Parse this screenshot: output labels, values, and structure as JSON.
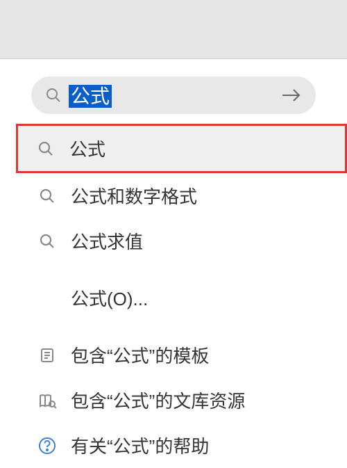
{
  "search": {
    "value": "公式"
  },
  "suggestions": [
    {
      "label": "公式",
      "icon": "search",
      "highlighted": true
    },
    {
      "label": "公式和数字格式",
      "icon": "search",
      "highlighted": false
    },
    {
      "label": "公式求值",
      "icon": "search",
      "highlighted": false
    }
  ],
  "commands": [
    {
      "label": "公式(O)...",
      "icon": "none"
    }
  ],
  "resources": [
    {
      "label": "包含“公式”的模板",
      "icon": "template"
    },
    {
      "label": "包含“公式”的文库资源",
      "icon": "library"
    },
    {
      "label": "有关“公式”的帮助",
      "icon": "help"
    }
  ]
}
